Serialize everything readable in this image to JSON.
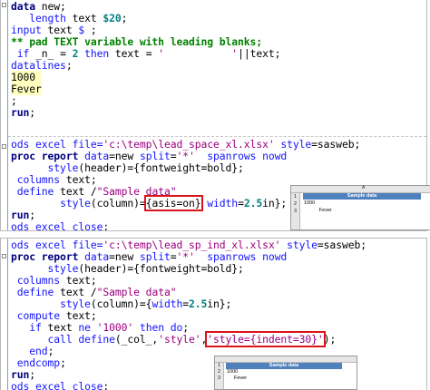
{
  "editor": {
    "block1": {
      "lines": [
        [
          {
            "t": "data",
            "c": "dk"
          },
          {
            "t": " new;",
            "c": "pl"
          }
        ],
        [
          {
            "t": "   ",
            "c": "pl"
          },
          {
            "t": "length",
            "c": "kw"
          },
          {
            "t": " text ",
            "c": "pl"
          },
          {
            "t": "$20",
            "c": "nm"
          },
          {
            "t": ";",
            "c": "pl"
          }
        ],
        [
          {
            "t": "input",
            "c": "kw"
          },
          {
            "t": " text ",
            "c": "pl"
          },
          {
            "t": "$",
            "c": "kw"
          },
          {
            "t": " ;",
            "c": "pl"
          }
        ],
        [
          {
            "t": "** pad TEXT variable with leading blanks;",
            "c": "cm"
          }
        ],
        [
          {
            "t": " ",
            "c": "pl"
          },
          {
            "t": "if",
            "c": "kw"
          },
          {
            "t": " _n_ = ",
            "c": "pl"
          },
          {
            "t": "2",
            "c": "nm"
          },
          {
            "t": " ",
            "c": "pl"
          },
          {
            "t": "then",
            "c": "kw"
          },
          {
            "t": " text = ",
            "c": "pl"
          },
          {
            "t": "'           '",
            "c": "st"
          },
          {
            "t": "||text;",
            "c": "pl"
          }
        ],
        [
          {
            "t": "datalines",
            "c": "kw"
          },
          {
            "t": ";",
            "c": "pl"
          }
        ],
        [
          {
            "t": "1000 ",
            "c": "dl"
          }
        ],
        [
          {
            "t": "Fever",
            "c": "dl"
          }
        ],
        [
          {
            "t": ";",
            "c": "pl"
          }
        ],
        [
          {
            "t": "run",
            "c": "dk"
          },
          {
            "t": ";",
            "c": "pl"
          }
        ]
      ],
      "ods_line": [
        {
          "t": "ods excel ",
          "c": "kw"
        },
        {
          "t": "file=",
          "c": "kw"
        },
        {
          "t": "'c:\\temp\\lead_space_xl.xlsx'",
          "c": "st"
        },
        {
          "t": " ",
          "c": "pl"
        },
        {
          "t": "style",
          "c": "kw"
        },
        {
          "t": "=sasweb;",
          "c": "pl"
        }
      ],
      "proc_lines": [
        [
          {
            "t": "proc report",
            "c": "dk"
          },
          {
            "t": " ",
            "c": "pl"
          },
          {
            "t": "data",
            "c": "kw"
          },
          {
            "t": "=new ",
            "c": "pl"
          },
          {
            "t": "split",
            "c": "kw"
          },
          {
            "t": "=",
            "c": "pl"
          },
          {
            "t": "'*'",
            "c": "st"
          },
          {
            "t": "  ",
            "c": "pl"
          },
          {
            "t": "spanrows nowd",
            "c": "kw"
          }
        ],
        [
          {
            "t": "      ",
            "c": "pl"
          },
          {
            "t": "style",
            "c": "kw"
          },
          {
            "t": "(header)={fontweight=bold};",
            "c": "pl"
          }
        ],
        [
          {
            "t": " ",
            "c": "pl"
          },
          {
            "t": "columns",
            "c": "kw"
          },
          {
            "t": " text;",
            "c": "pl"
          }
        ],
        [
          {
            "t": " ",
            "c": "pl"
          },
          {
            "t": "define",
            "c": "kw"
          },
          {
            "t": " text /",
            "c": "pl"
          },
          {
            "t": "\"Sample data\"",
            "c": "st"
          }
        ],
        [
          {
            "t": "        ",
            "c": "pl"
          },
          {
            "t": "style",
            "c": "kw"
          },
          {
            "t": "(column)=",
            "c": "pl"
          },
          {
            "t": "{asis=on}",
            "c": "pl",
            "hl": true
          },
          {
            "t": " ",
            "c": "pl"
          },
          {
            "t": "width",
            "c": "kw"
          },
          {
            "t": "=",
            "c": "pl"
          },
          {
            "t": "2.5",
            "c": "nm"
          },
          {
            "t": "in};",
            "c": "pl"
          }
        ],
        [
          {
            "t": "run",
            "c": "dk"
          },
          {
            "t": ";",
            "c": "pl"
          }
        ],
        [
          {
            "t": "ods excel close",
            "c": "kw"
          },
          {
            "t": ";",
            "c": "pl"
          }
        ]
      ]
    },
    "block2": {
      "lines": [
        [
          {
            "t": "ods excel ",
            "c": "kw"
          },
          {
            "t": "file=",
            "c": "kw"
          },
          {
            "t": "'c:\\temp\\lead_sp_ind_xl.xlsx'",
            "c": "st"
          },
          {
            "t": " ",
            "c": "pl"
          },
          {
            "t": "style",
            "c": "kw"
          },
          {
            "t": "=sasweb;",
            "c": "pl"
          }
        ],
        [
          {
            "t": "proc report",
            "c": "dk"
          },
          {
            "t": " ",
            "c": "pl"
          },
          {
            "t": "data",
            "c": "kw"
          },
          {
            "t": "=new ",
            "c": "pl"
          },
          {
            "t": "split",
            "c": "kw"
          },
          {
            "t": "=",
            "c": "pl"
          },
          {
            "t": "'*'",
            "c": "st"
          },
          {
            "t": "  ",
            "c": "pl"
          },
          {
            "t": "spanrows nowd",
            "c": "kw"
          }
        ],
        [
          {
            "t": "      ",
            "c": "pl"
          },
          {
            "t": "style",
            "c": "kw"
          },
          {
            "t": "(header)={fontweight=bold};",
            "c": "pl"
          }
        ],
        [
          {
            "t": " ",
            "c": "pl"
          },
          {
            "t": "columns",
            "c": "kw"
          },
          {
            "t": " text;",
            "c": "pl"
          }
        ],
        [
          {
            "t": " ",
            "c": "pl"
          },
          {
            "t": "define",
            "c": "kw"
          },
          {
            "t": " text /",
            "c": "pl"
          },
          {
            "t": "\"Sample data\"",
            "c": "st"
          }
        ],
        [
          {
            "t": "        ",
            "c": "pl"
          },
          {
            "t": "style",
            "c": "kw"
          },
          {
            "t": "(column)={",
            "c": "pl"
          },
          {
            "t": "width",
            "c": "kw"
          },
          {
            "t": "=",
            "c": "pl"
          },
          {
            "t": "2.5",
            "c": "nm"
          },
          {
            "t": "in};",
            "c": "pl"
          }
        ],
        [
          {
            "t": " ",
            "c": "pl"
          },
          {
            "t": "compute",
            "c": "kw"
          },
          {
            "t": " text;",
            "c": "pl"
          }
        ],
        [
          {
            "t": "   ",
            "c": "pl"
          },
          {
            "t": "if",
            "c": "kw"
          },
          {
            "t": " text ",
            "c": "pl"
          },
          {
            "t": "ne",
            "c": "kw"
          },
          {
            "t": " ",
            "c": "pl"
          },
          {
            "t": "'1000'",
            "c": "st"
          },
          {
            "t": " ",
            "c": "pl"
          },
          {
            "t": "then do",
            "c": "kw"
          },
          {
            "t": ";",
            "c": "pl"
          }
        ],
        [
          {
            "t": "      ",
            "c": "pl"
          },
          {
            "t": "call define",
            "c": "kw"
          },
          {
            "t": "(_col_,",
            "c": "pl"
          },
          {
            "t": "'style'",
            "c": "st"
          },
          {
            "t": ",",
            "c": "pl"
          },
          {
            "t": "'style={indent=30}'",
            "c": "st",
            "hl": true
          },
          {
            "t": ");",
            "c": "pl"
          }
        ],
        [
          {
            "t": "   ",
            "c": "pl"
          },
          {
            "t": "end",
            "c": "kw"
          },
          {
            "t": ";",
            "c": "pl"
          }
        ],
        [
          {
            "t": " ",
            "c": "pl"
          },
          {
            "t": "endcomp",
            "c": "kw"
          },
          {
            "t": ";",
            "c": "pl"
          }
        ],
        [
          {
            "t": "run",
            "c": "dk"
          },
          {
            "t": ";",
            "c": "pl"
          }
        ],
        [
          {
            "t": "ods excel close",
            "c": "kw"
          },
          {
            "t": ";",
            "c": "pl"
          }
        ]
      ]
    }
  },
  "sheet1": {
    "col_letter": "A",
    "header": "Sample data",
    "rows": [
      {
        "num": "1",
        "value": ""
      },
      {
        "num": "2",
        "value": "1000"
      },
      {
        "num": "3",
        "value": "           Fever"
      }
    ]
  },
  "sheet2": {
    "header": "Sample data",
    "rows": [
      {
        "num": "1",
        "value": ""
      },
      {
        "num": "2",
        "value": "1000"
      },
      {
        "num": "3",
        "value": "Fever",
        "indent": true
      }
    ]
  },
  "colors": {
    "keyword": "#1414ff",
    "data_step": "#000080",
    "string": "#9a0080",
    "comment": "#008000",
    "number": "#008080",
    "highlight_box": "#d9151b",
    "datalines_bg": "#ffffc0",
    "excel_header": "#4f81bd"
  }
}
